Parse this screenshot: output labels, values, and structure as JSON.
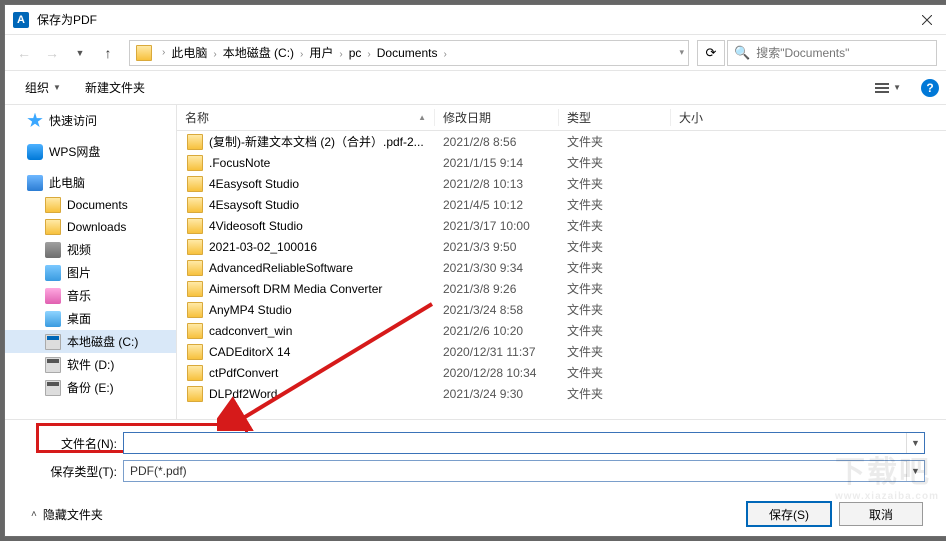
{
  "window_title": "保存为PDF",
  "breadcrumb": [
    "此电脑",
    "本地磁盘 (C:)",
    "用户",
    "pc",
    "Documents"
  ],
  "search_placeholder": "搜索\"Documents\"",
  "toolbar": {
    "organize": "组织",
    "new_folder": "新建文件夹"
  },
  "columns": {
    "name": "名称",
    "date": "修改日期",
    "type": "类型",
    "size": "大小"
  },
  "sidebar": {
    "quick": "快速访问",
    "wps": "WPS网盘",
    "pc": "此电脑",
    "children": [
      {
        "label": "Documents",
        "icon": "ti-folder-sm"
      },
      {
        "label": "Downloads",
        "icon": "ti-folder-sm"
      },
      {
        "label": "视频",
        "icon": "ti-media"
      },
      {
        "label": "图片",
        "icon": "ti-img"
      },
      {
        "label": "音乐",
        "icon": "ti-music"
      },
      {
        "label": "桌面",
        "icon": "ti-desktop"
      },
      {
        "label": "本地磁盘 (C:)",
        "icon": "ti-disk",
        "selected": true
      },
      {
        "label": "软件 (D:)",
        "icon": "ti-disk dark"
      },
      {
        "label": "备份 (E:)",
        "icon": "ti-disk dark"
      }
    ]
  },
  "files": [
    {
      "name": "(复制)-新建文本文档 (2)（合并）.pdf-2...",
      "date": "2021/2/8 8:56",
      "type": "文件夹"
    },
    {
      "name": ".FocusNote",
      "date": "2021/1/15 9:14",
      "type": "文件夹"
    },
    {
      "name": "4Easysoft Studio",
      "date": "2021/2/8 10:13",
      "type": "文件夹"
    },
    {
      "name": "4Esaysoft Studio",
      "date": "2021/4/5 10:12",
      "type": "文件夹"
    },
    {
      "name": "4Videosoft Studio",
      "date": "2021/3/17 10:00",
      "type": "文件夹"
    },
    {
      "name": "2021-03-02_100016",
      "date": "2021/3/3 9:50",
      "type": "文件夹"
    },
    {
      "name": "AdvancedReliableSoftware",
      "date": "2021/3/30 9:34",
      "type": "文件夹"
    },
    {
      "name": "Aimersoft DRM Media Converter",
      "date": "2021/3/8 9:26",
      "type": "文件夹"
    },
    {
      "name": "AnyMP4 Studio",
      "date": "2021/3/24 8:58",
      "type": "文件夹"
    },
    {
      "name": "cadconvert_win",
      "date": "2021/2/6 10:20",
      "type": "文件夹"
    },
    {
      "name": "CADEditorX 14",
      "date": "2020/12/31 11:37",
      "type": "文件夹"
    },
    {
      "name": "ctPdfConvert",
      "date": "2020/12/28 10:34",
      "type": "文件夹"
    },
    {
      "name": "DLPdf2Word",
      "date": "2021/3/24 9:30",
      "type": "文件夹"
    }
  ],
  "filename_label": "文件名(N):",
  "filetype_label": "保存类型(T):",
  "filetype_value": "PDF(*.pdf)",
  "hide_folders": "隐藏文件夹",
  "save_label": "保存(S)",
  "cancel_label": "取消",
  "watermark": {
    "main": "下载吧",
    "sub": "www.xiazaiba.com"
  }
}
